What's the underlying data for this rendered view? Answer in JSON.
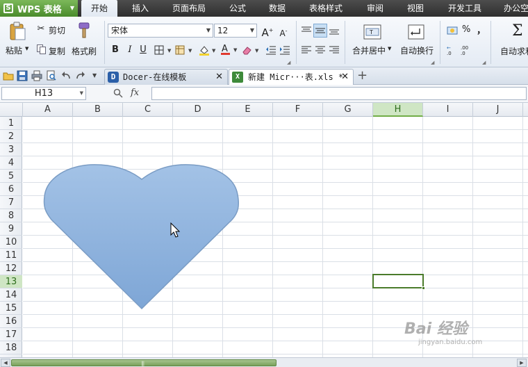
{
  "app": {
    "logo": "WPS 表格",
    "logo_mark": "S",
    "menu_tabs": [
      "开始",
      "插入",
      "页面布局",
      "公式",
      "数据",
      "表格样式",
      "审阅",
      "视图",
      "开发工具",
      "办公空"
    ],
    "active_tab": "开始"
  },
  "ribbon": {
    "paste": "粘贴",
    "cut": "剪切",
    "copy": "复制",
    "format_painter": "格式刷",
    "font_name": "宋体",
    "font_size": "12",
    "bold": "B",
    "italic": "I",
    "underline": "U",
    "merge_center": "合并居中",
    "wrap_text": "自动换行",
    "percent": "%",
    "comma": "，",
    "autosum": "自动求和"
  },
  "doc_tabs": [
    {
      "label": "Docer-在线模板",
      "active": false
    },
    {
      "label": "新建 Micr···表.xls *",
      "active": true
    }
  ],
  "formula_bar": {
    "name_box": "H13",
    "fx_label": "fx",
    "formula": ""
  },
  "sheet": {
    "columns": [
      "A",
      "B",
      "C",
      "D",
      "E",
      "F",
      "G",
      "H",
      "I",
      "J"
    ],
    "rows": [
      "1",
      "2",
      "3",
      "4",
      "5",
      "6",
      "7",
      "8",
      "9",
      "10",
      "11",
      "12",
      "13",
      "14",
      "15",
      "16",
      "17",
      "18"
    ],
    "selected_cell": "H13",
    "selected_column": "H",
    "selected_row": "13",
    "shape": {
      "type": "heart",
      "fill_top": "#a3c2e6",
      "fill_bottom": "#7ea6d6",
      "stroke": "#7a9cc4"
    }
  },
  "colors": {
    "accent_green": "#70ad47",
    "menubar": "#3a3a3a"
  },
  "watermark": {
    "line1": "Bai 经验",
    "line2": "jingyan.baidu.com"
  }
}
